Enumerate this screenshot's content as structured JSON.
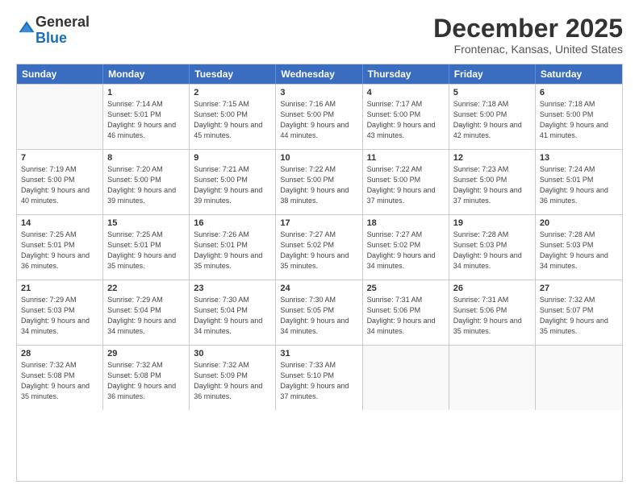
{
  "logo": {
    "general": "General",
    "blue": "Blue"
  },
  "title": "December 2025",
  "subtitle": "Frontenac, Kansas, United States",
  "days_of_week": [
    "Sunday",
    "Monday",
    "Tuesday",
    "Wednesday",
    "Thursday",
    "Friday",
    "Saturday"
  ],
  "weeks": [
    [
      {
        "day": "",
        "empty": true
      },
      {
        "day": "1",
        "sunrise": "Sunrise: 7:14 AM",
        "sunset": "Sunset: 5:01 PM",
        "daylight": "Daylight: 9 hours and 46 minutes."
      },
      {
        "day": "2",
        "sunrise": "Sunrise: 7:15 AM",
        "sunset": "Sunset: 5:00 PM",
        "daylight": "Daylight: 9 hours and 45 minutes."
      },
      {
        "day": "3",
        "sunrise": "Sunrise: 7:16 AM",
        "sunset": "Sunset: 5:00 PM",
        "daylight": "Daylight: 9 hours and 44 minutes."
      },
      {
        "day": "4",
        "sunrise": "Sunrise: 7:17 AM",
        "sunset": "Sunset: 5:00 PM",
        "daylight": "Daylight: 9 hours and 43 minutes."
      },
      {
        "day": "5",
        "sunrise": "Sunrise: 7:18 AM",
        "sunset": "Sunset: 5:00 PM",
        "daylight": "Daylight: 9 hours and 42 minutes."
      },
      {
        "day": "6",
        "sunrise": "Sunrise: 7:18 AM",
        "sunset": "Sunset: 5:00 PM",
        "daylight": "Daylight: 9 hours and 41 minutes."
      }
    ],
    [
      {
        "day": "7",
        "sunrise": "Sunrise: 7:19 AM",
        "sunset": "Sunset: 5:00 PM",
        "daylight": "Daylight: 9 hours and 40 minutes."
      },
      {
        "day": "8",
        "sunrise": "Sunrise: 7:20 AM",
        "sunset": "Sunset: 5:00 PM",
        "daylight": "Daylight: 9 hours and 39 minutes."
      },
      {
        "day": "9",
        "sunrise": "Sunrise: 7:21 AM",
        "sunset": "Sunset: 5:00 PM",
        "daylight": "Daylight: 9 hours and 39 minutes."
      },
      {
        "day": "10",
        "sunrise": "Sunrise: 7:22 AM",
        "sunset": "Sunset: 5:00 PM",
        "daylight": "Daylight: 9 hours and 38 minutes."
      },
      {
        "day": "11",
        "sunrise": "Sunrise: 7:22 AM",
        "sunset": "Sunset: 5:00 PM",
        "daylight": "Daylight: 9 hours and 37 minutes."
      },
      {
        "day": "12",
        "sunrise": "Sunrise: 7:23 AM",
        "sunset": "Sunset: 5:00 PM",
        "daylight": "Daylight: 9 hours and 37 minutes."
      },
      {
        "day": "13",
        "sunrise": "Sunrise: 7:24 AM",
        "sunset": "Sunset: 5:01 PM",
        "daylight": "Daylight: 9 hours and 36 minutes."
      }
    ],
    [
      {
        "day": "14",
        "sunrise": "Sunrise: 7:25 AM",
        "sunset": "Sunset: 5:01 PM",
        "daylight": "Daylight: 9 hours and 36 minutes."
      },
      {
        "day": "15",
        "sunrise": "Sunrise: 7:25 AM",
        "sunset": "Sunset: 5:01 PM",
        "daylight": "Daylight: 9 hours and 35 minutes."
      },
      {
        "day": "16",
        "sunrise": "Sunrise: 7:26 AM",
        "sunset": "Sunset: 5:01 PM",
        "daylight": "Daylight: 9 hours and 35 minutes."
      },
      {
        "day": "17",
        "sunrise": "Sunrise: 7:27 AM",
        "sunset": "Sunset: 5:02 PM",
        "daylight": "Daylight: 9 hours and 35 minutes."
      },
      {
        "day": "18",
        "sunrise": "Sunrise: 7:27 AM",
        "sunset": "Sunset: 5:02 PM",
        "daylight": "Daylight: 9 hours and 34 minutes."
      },
      {
        "day": "19",
        "sunrise": "Sunrise: 7:28 AM",
        "sunset": "Sunset: 5:03 PM",
        "daylight": "Daylight: 9 hours and 34 minutes."
      },
      {
        "day": "20",
        "sunrise": "Sunrise: 7:28 AM",
        "sunset": "Sunset: 5:03 PM",
        "daylight": "Daylight: 9 hours and 34 minutes."
      }
    ],
    [
      {
        "day": "21",
        "sunrise": "Sunrise: 7:29 AM",
        "sunset": "Sunset: 5:03 PM",
        "daylight": "Daylight: 9 hours and 34 minutes."
      },
      {
        "day": "22",
        "sunrise": "Sunrise: 7:29 AM",
        "sunset": "Sunset: 5:04 PM",
        "daylight": "Daylight: 9 hours and 34 minutes."
      },
      {
        "day": "23",
        "sunrise": "Sunrise: 7:30 AM",
        "sunset": "Sunset: 5:04 PM",
        "daylight": "Daylight: 9 hours and 34 minutes."
      },
      {
        "day": "24",
        "sunrise": "Sunrise: 7:30 AM",
        "sunset": "Sunset: 5:05 PM",
        "daylight": "Daylight: 9 hours and 34 minutes."
      },
      {
        "day": "25",
        "sunrise": "Sunrise: 7:31 AM",
        "sunset": "Sunset: 5:06 PM",
        "daylight": "Daylight: 9 hours and 34 minutes."
      },
      {
        "day": "26",
        "sunrise": "Sunrise: 7:31 AM",
        "sunset": "Sunset: 5:06 PM",
        "daylight": "Daylight: 9 hours and 35 minutes."
      },
      {
        "day": "27",
        "sunrise": "Sunrise: 7:32 AM",
        "sunset": "Sunset: 5:07 PM",
        "daylight": "Daylight: 9 hours and 35 minutes."
      }
    ],
    [
      {
        "day": "28",
        "sunrise": "Sunrise: 7:32 AM",
        "sunset": "Sunset: 5:08 PM",
        "daylight": "Daylight: 9 hours and 35 minutes."
      },
      {
        "day": "29",
        "sunrise": "Sunrise: 7:32 AM",
        "sunset": "Sunset: 5:08 PM",
        "daylight": "Daylight: 9 hours and 36 minutes."
      },
      {
        "day": "30",
        "sunrise": "Sunrise: 7:32 AM",
        "sunset": "Sunset: 5:09 PM",
        "daylight": "Daylight: 9 hours and 36 minutes."
      },
      {
        "day": "31",
        "sunrise": "Sunrise: 7:33 AM",
        "sunset": "Sunset: 5:10 PM",
        "daylight": "Daylight: 9 hours and 37 minutes."
      },
      {
        "day": "",
        "empty": true
      },
      {
        "day": "",
        "empty": true
      },
      {
        "day": "",
        "empty": true
      }
    ]
  ]
}
